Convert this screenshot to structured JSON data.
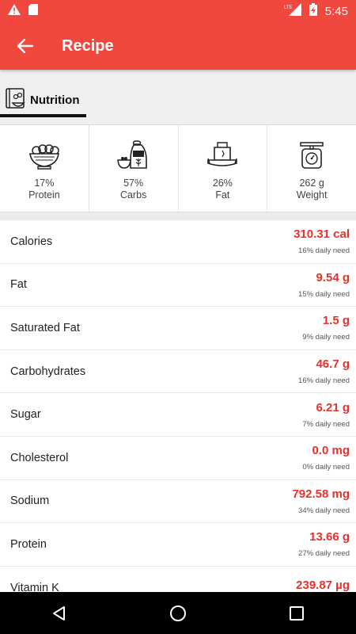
{
  "status_bar": {
    "time": "5:45",
    "network": "LTE"
  },
  "app_bar": {
    "title": "Recipe"
  },
  "tab": {
    "label": "Nutrition"
  },
  "macros": [
    {
      "percent": "17%",
      "label": "Protein",
      "icon": "protein-bowl-icon"
    },
    {
      "percent": "57%",
      "label": "Carbs",
      "icon": "carbs-sack-icon"
    },
    {
      "percent": "26%",
      "label": "Fat",
      "icon": "fat-butter-icon"
    },
    {
      "percent": "262 g",
      "label": "Weight",
      "icon": "weight-scale-icon"
    }
  ],
  "nutrients": [
    {
      "name": "Calories",
      "amount": "310.31 cal",
      "daily": "16% daily need"
    },
    {
      "name": "Fat",
      "amount": "9.54 g",
      "daily": "15% daily need"
    },
    {
      "name": "Saturated Fat",
      "amount": "1.5 g",
      "daily": "9% daily need"
    },
    {
      "name": "Carbohydrates",
      "amount": "46.7 g",
      "daily": "16% daily need"
    },
    {
      "name": "Sugar",
      "amount": "6.21 g",
      "daily": "7% daily need"
    },
    {
      "name": "Cholesterol",
      "amount": "0.0 mg",
      "daily": "0% daily need"
    },
    {
      "name": "Sodium",
      "amount": "792.58 mg",
      "daily": "34% daily need"
    },
    {
      "name": "Protein",
      "amount": "13.66 g",
      "daily": "27% daily need"
    },
    {
      "name": "Vitamin K",
      "amount": "239.87 µg",
      "daily": ""
    }
  ],
  "colors": {
    "primary": "#f0473f",
    "accent_text": "#e8312b"
  }
}
